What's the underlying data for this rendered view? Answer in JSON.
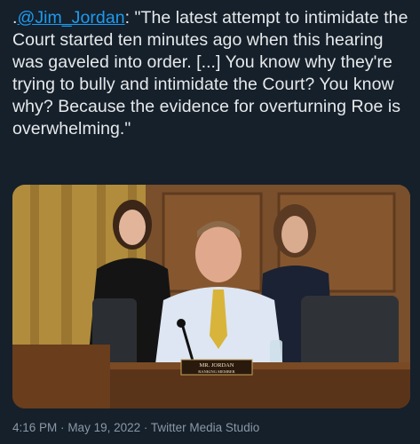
{
  "tweet": {
    "prefix": ".",
    "mention": "@Jim_Jordan",
    "text": ": \"The latest attempt to intimidate the Court started ten minutes ago when this hearing was gaveled into order. [...] You know why they're trying to bully and intimidate the Court? You know why? Because the evidence for overturning Roe is overwhelming.\""
  },
  "media": {
    "nameplate_name": "MR. JORDAN",
    "nameplate_title": "RANKING MEMBER"
  },
  "meta": {
    "time": "4:16 PM",
    "separator1": "·",
    "date": "May 19, 2022",
    "separator2": "·",
    "source": "Twitter Media Studio"
  }
}
